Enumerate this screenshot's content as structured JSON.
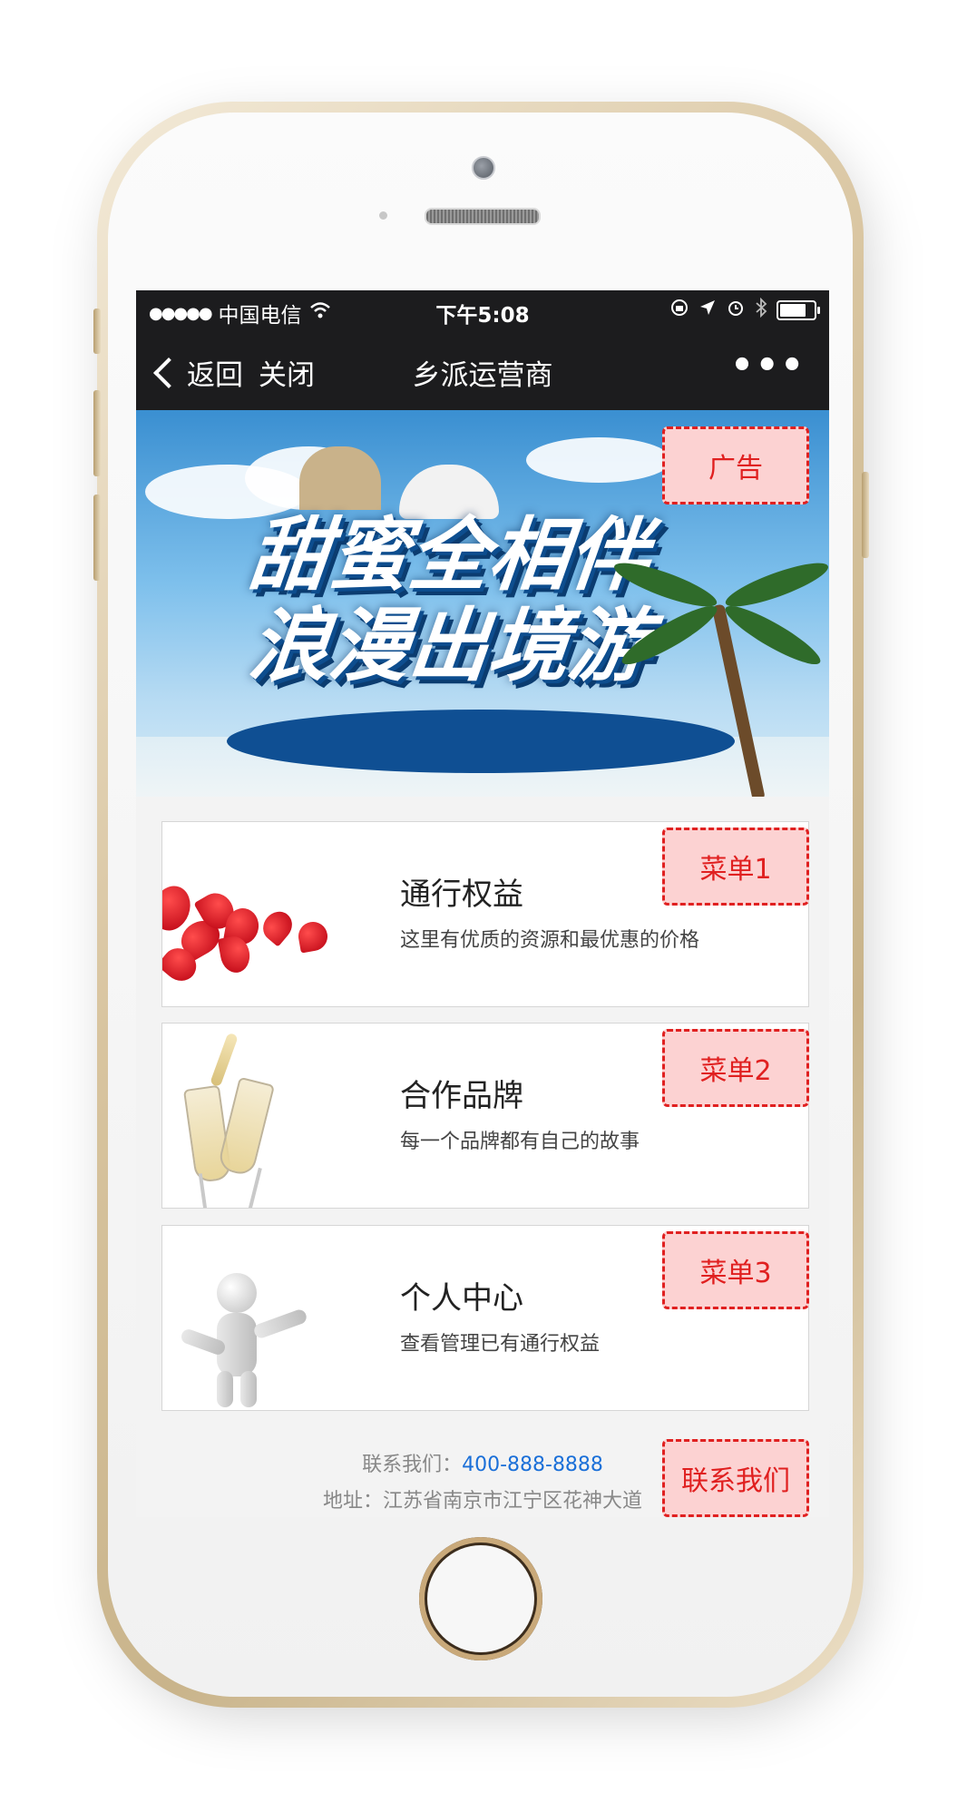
{
  "status_bar": {
    "signal": "●●●●●",
    "carrier": "中国电信",
    "time": "下午5:08"
  },
  "nav": {
    "back_label": "返回",
    "close_label": "关闭",
    "title": "乡派运营商",
    "more_label": "•••"
  },
  "banner": {
    "line1": "甜蜜全相伴",
    "line2": "浪漫出境游"
  },
  "annotations": {
    "ad": "广告",
    "menu1": "菜单1",
    "menu2": "菜单2",
    "menu3": "菜单3",
    "contact": "联系我们"
  },
  "menus": [
    {
      "title": "通行权益",
      "subtitle": "这里有优质的资源和最优惠的价格",
      "image": "rose-petals"
    },
    {
      "title": "合作品牌",
      "subtitle": "每一个品牌都有自己的故事",
      "image": "champagne-glasses"
    },
    {
      "title": "个人中心",
      "subtitle": "查看管理已有通行权益",
      "image": "3d-person"
    }
  ],
  "footer": {
    "contact_label": "联系我们：",
    "phone": "400-888-8888",
    "address": "地址：江苏省南京市江宁区花神大道"
  },
  "colors": {
    "annotation_border": "#e02020",
    "annotation_fill": "#fcd2d2",
    "link": "#1a6fd8",
    "nav_bg": "#1c1c1e"
  }
}
